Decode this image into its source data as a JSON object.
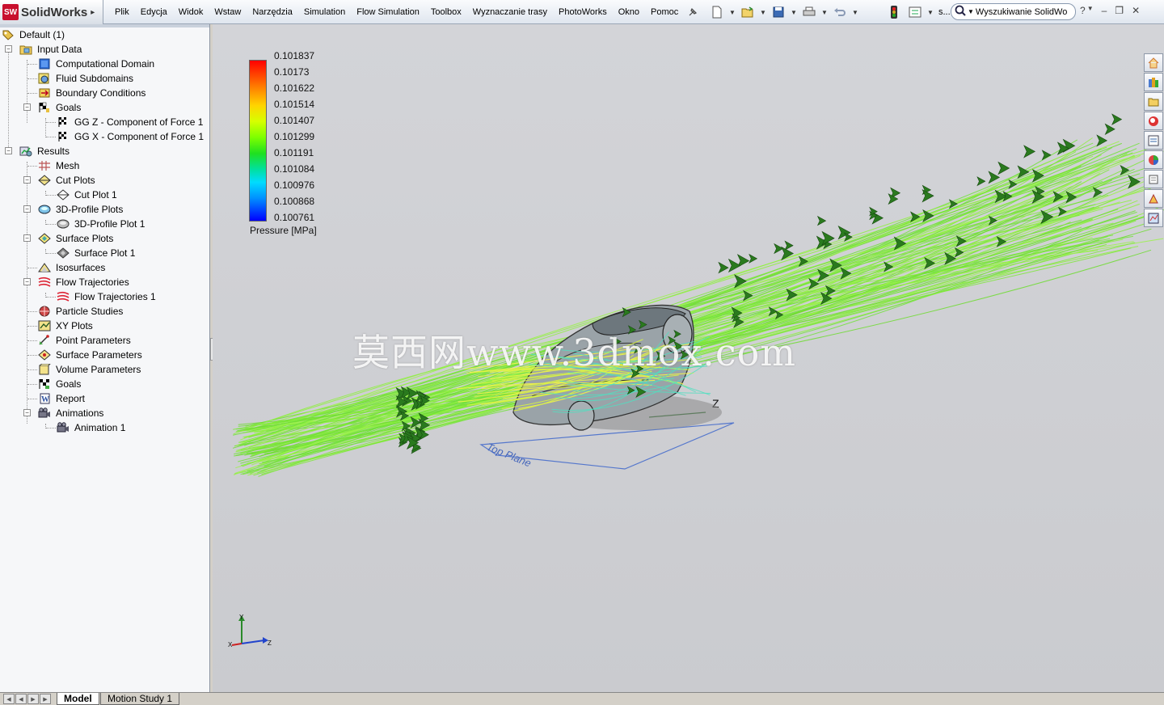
{
  "app": {
    "logo_badge": "SW",
    "logo_text": "SolidWorks",
    "logo_arrow": "▸"
  },
  "menu": [
    "Plik",
    "Edycja",
    "Widok",
    "Wstaw",
    "Narzędzia",
    "Simulation",
    "Flow Simulation",
    "Toolbox",
    "Wyznaczanie trasy",
    "PhotoWorks",
    "Okno",
    "Pomoc"
  ],
  "toolbar": {
    "more_label": "s..."
  },
  "search": {
    "placeholder": "Wyszukiwanie SolidWo"
  },
  "tree": {
    "root": "Default (1)",
    "items": [
      {
        "label": "Input Data"
      },
      {
        "label": "Computational Domain"
      },
      {
        "label": "Fluid Subdomains"
      },
      {
        "label": "Boundary Conditions"
      },
      {
        "label": "Goals"
      },
      {
        "label": "GG Z - Component of Force 1"
      },
      {
        "label": "GG X - Component of Force 1"
      },
      {
        "label": "Results"
      },
      {
        "label": "Mesh"
      },
      {
        "label": "Cut Plots"
      },
      {
        "label": "Cut Plot 1"
      },
      {
        "label": "3D-Profile Plots"
      },
      {
        "label": "3D-Profile Plot 1"
      },
      {
        "label": "Surface Plots"
      },
      {
        "label": "Surface Plot 1"
      },
      {
        "label": "Isosurfaces"
      },
      {
        "label": "Flow Trajectories"
      },
      {
        "label": "Flow Trajectories 1"
      },
      {
        "label": "Particle Studies"
      },
      {
        "label": "XY Plots"
      },
      {
        "label": "Point Parameters"
      },
      {
        "label": "Surface Parameters"
      },
      {
        "label": "Volume Parameters"
      },
      {
        "label": "Goals"
      },
      {
        "label": "Report"
      },
      {
        "label": "Animations"
      },
      {
        "label": "Animation 1"
      }
    ]
  },
  "legend": {
    "values": [
      "0.101837",
      "0.10173",
      "0.101622",
      "0.101514",
      "0.101407",
      "0.101299",
      "0.101191",
      "0.101084",
      "0.100976",
      "0.100868",
      "0.100761"
    ],
    "title": "Pressure [MPa]"
  },
  "viewport": {
    "watermark": "莫西网www.3dmox.com",
    "plane_label": "Top Plane",
    "axis_z": "Z",
    "triad": {
      "x": "X",
      "y": "Y",
      "z": "Z"
    }
  },
  "bottom_tabs": [
    "Model",
    "Motion Study 1"
  ]
}
